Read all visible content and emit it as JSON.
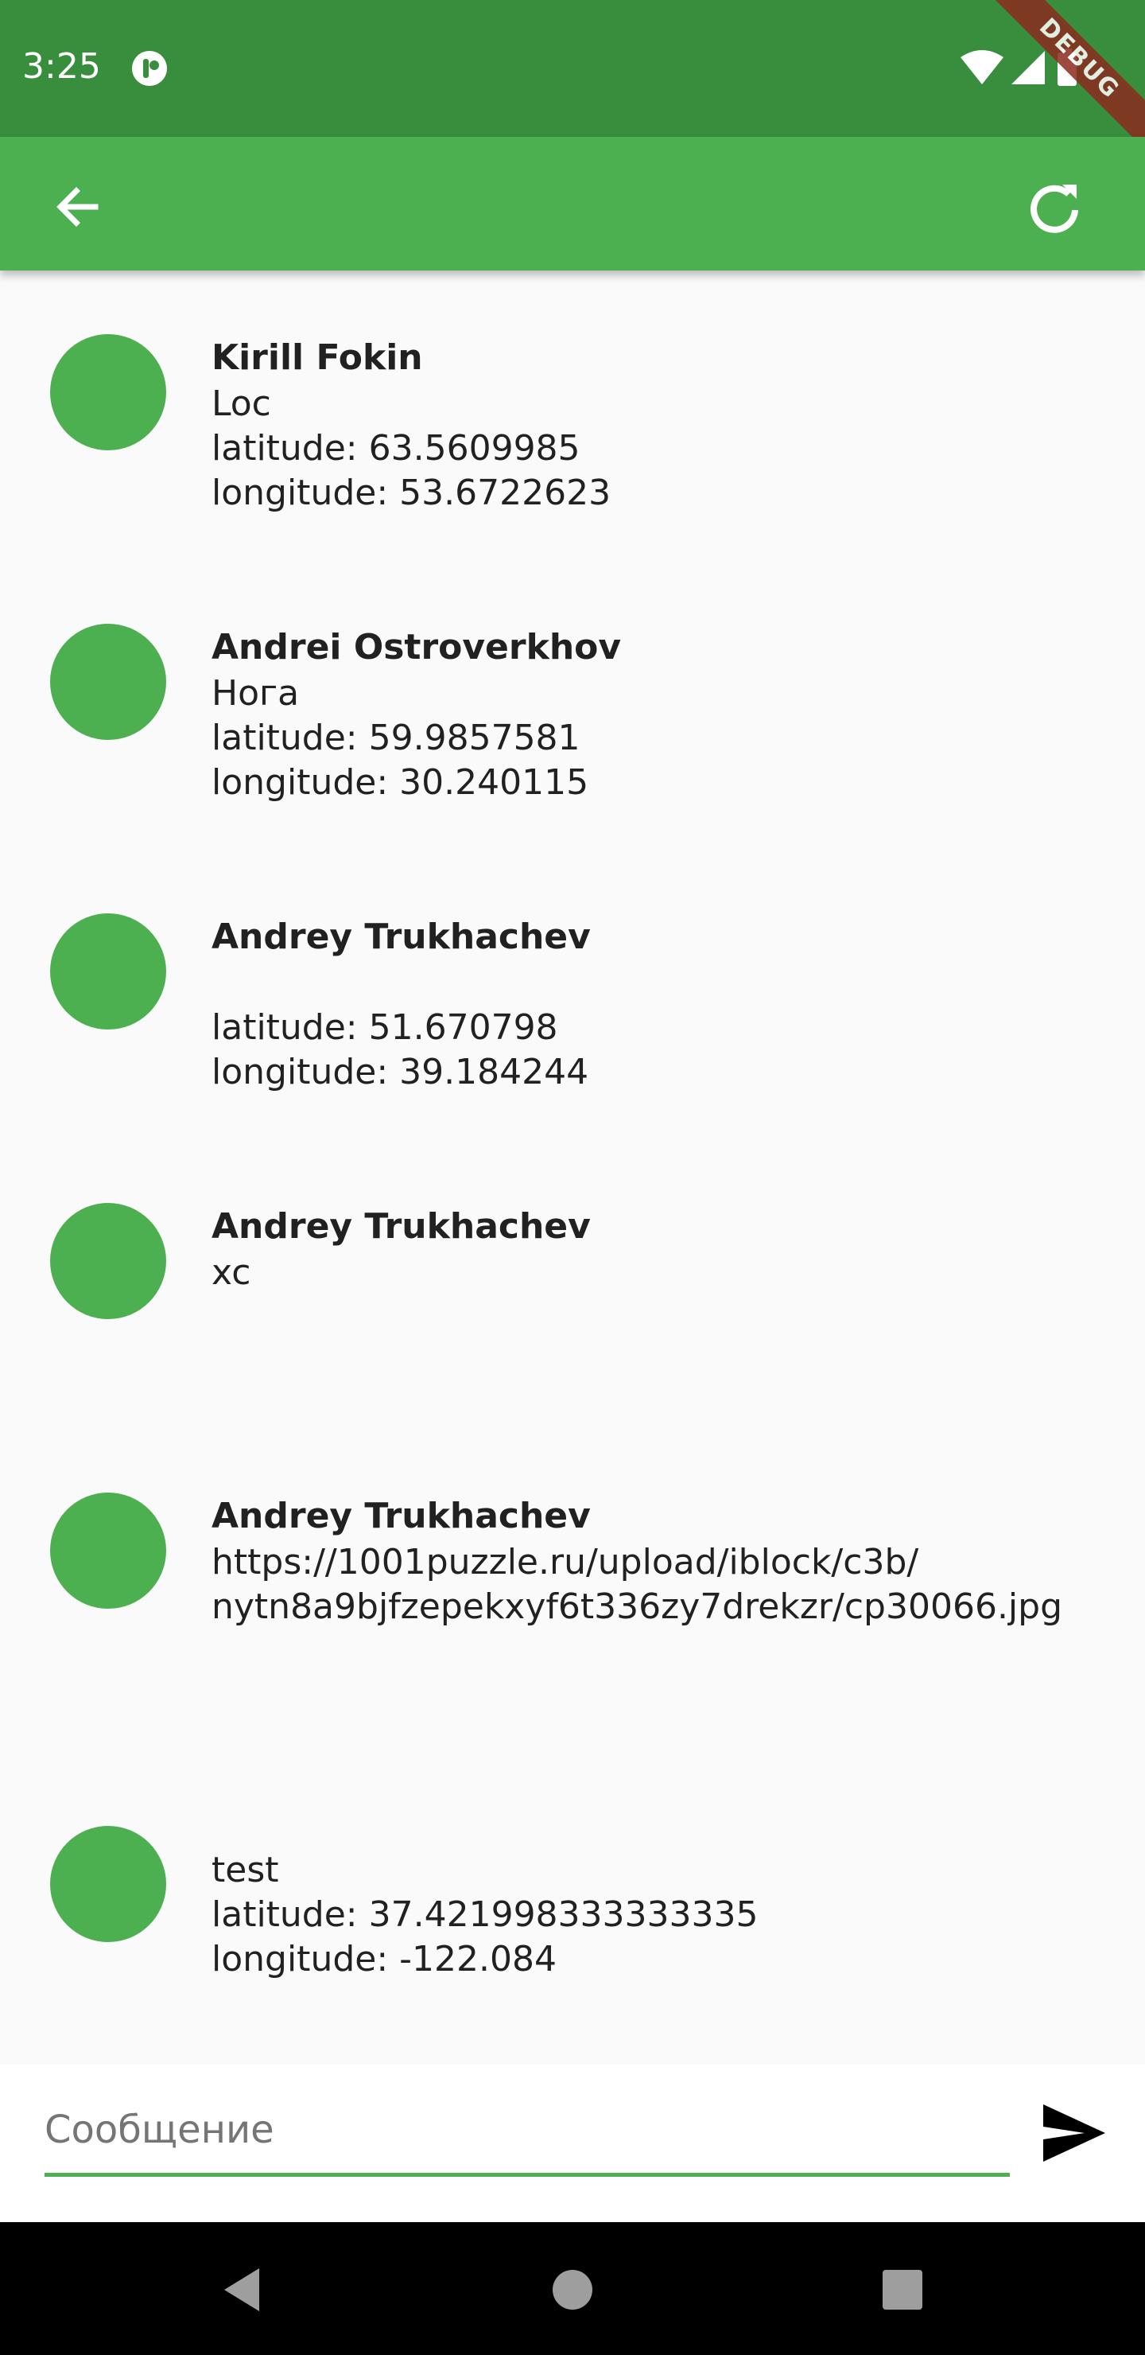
{
  "status_bar": {
    "time": "3:25",
    "icons": [
      "app-notification-icon",
      "wifi-icon",
      "signal-icon",
      "battery-icon"
    ],
    "debug_label": "DEBUG"
  },
  "app_bar": {
    "background": "#4caf50",
    "actions": [
      "back-arrow-icon",
      "refresh-icon"
    ]
  },
  "messages": [
    {
      "author": "Kirill Fokin",
      "lines": [
        "Loc",
        "latitude: 63.5609985",
        "longitude: 53.6722623"
      ]
    },
    {
      "author": "Andrei Ostroverkhov",
      "lines": [
        "Нога",
        "latitude: 59.9857581",
        "longitude: 30.240115"
      ]
    },
    {
      "author": "Andrey Trukhachev",
      "lines": [
        "",
        "latitude: 51.670798",
        "longitude: 39.184244"
      ]
    },
    {
      "author": "Andrey Trukhachev",
      "lines": [
        "xc"
      ]
    },
    {
      "author": "Andrey Trukhachev",
      "lines": [
        "https://1001puzzle.ru/upload/iblock/c3b/",
        "nytn8a9bjfzepekxyf6t336zy7drekzr/cp30066.jpg"
      ]
    },
    {
      "author": "",
      "lines": [
        "test",
        "latitude: 37.421998333333335",
        "longitude: -122.084"
      ]
    }
  ],
  "composer": {
    "placeholder": "Сообщение",
    "value": ""
  },
  "colors": {
    "accent": "#4caf50",
    "status_bar": "#388e3c",
    "background": "#fafafa"
  }
}
